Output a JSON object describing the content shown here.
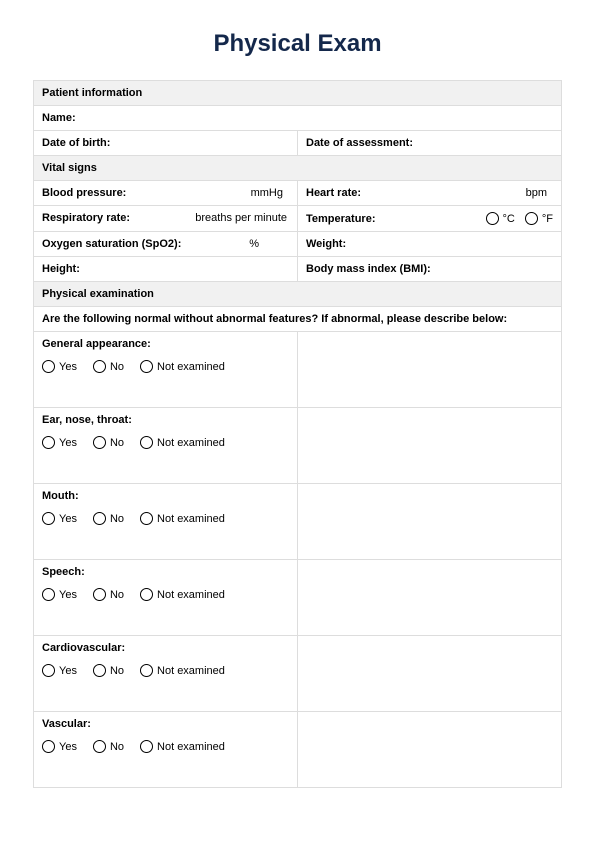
{
  "title": "Physical Exam",
  "sections": {
    "patient_info_header": "Patient information",
    "vital_signs_header": "Vital signs",
    "physical_exam_header": "Physical examination"
  },
  "labels": {
    "name": "Name:",
    "dob": "Date of birth:",
    "doa": "Date of assessment:",
    "bp": "Blood pressure:",
    "bp_unit": "mmHg",
    "hr": "Heart rate:",
    "hr_unit": "bpm",
    "rr": "Respiratory rate:",
    "rr_unit": "breaths per minute",
    "temp": "Temperature:",
    "temp_c": "°C",
    "temp_f": "°F",
    "spo2": "Oxygen saturation (SpO2):",
    "spo2_unit": "%",
    "weight": "Weight:",
    "height": "Height:",
    "bmi": "Body mass index (BMI):"
  },
  "instruction": "Are the following normal without abnormal features? If abnormal, please describe below:",
  "options": {
    "yes": "Yes",
    "no": "No",
    "not_examined": "Not examined"
  },
  "exam_items": [
    "General appearance:",
    "Ear, nose, throat:",
    "Mouth:",
    "Speech:",
    "Cardiovascular:",
    "Vascular:"
  ]
}
